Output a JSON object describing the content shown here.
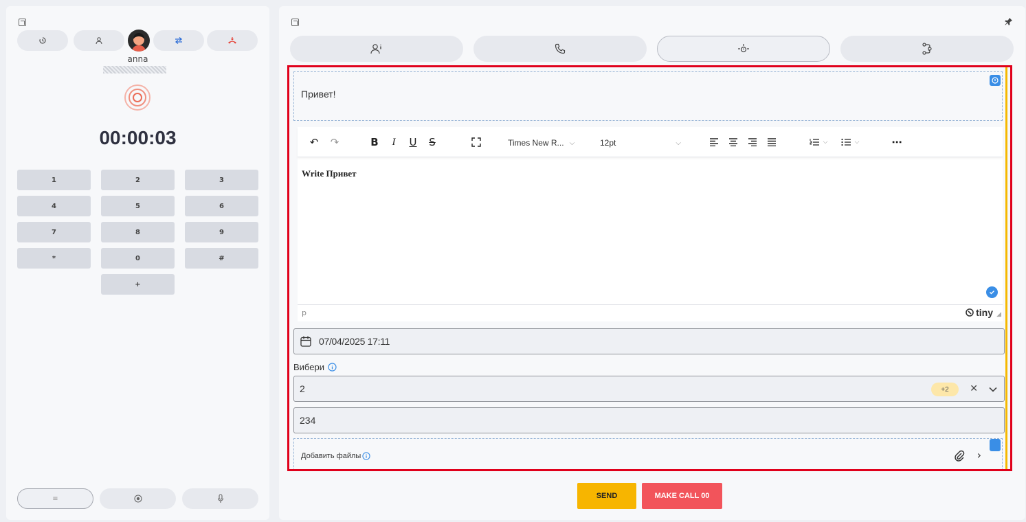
{
  "left_panel": {
    "caller_name": "anna",
    "caller_number_masked": "██████████",
    "timer": "00:00:03",
    "keypad": [
      "1",
      "2",
      "3",
      "4",
      "5",
      "6",
      "7",
      "8",
      "9",
      "*",
      "0",
      "#",
      "+"
    ],
    "bottom_buttons": [
      "menu-icon",
      "record-icon",
      "mic-icon"
    ]
  },
  "right_panel": {
    "tabs": [
      "contact-info-icon",
      "phone-icon",
      "hand-icon",
      "workflow-icon"
    ],
    "greeting_block": {
      "text": "Привет!"
    },
    "editor": {
      "font_family": "Times New R...",
      "font_size": "12pt",
      "content": "Write Привет",
      "status_path": "p",
      "brand": "tiny"
    },
    "datetime_field": {
      "value": "07/04/2025 17:11"
    },
    "select_label": "Вибери",
    "select_field": {
      "value": "2",
      "extra_badge": "+2"
    },
    "text_field": {
      "value": "234"
    },
    "files": {
      "label": "Добавить файлы"
    }
  },
  "actions": {
    "send_label": "SEND",
    "call_label": "MAKE CALL 00"
  },
  "colors": {
    "send": "#f7b500",
    "call": "#f2545b",
    "frame": "#e0001b",
    "accent_blue": "#3a8ee6",
    "badge": "#fde7a9",
    "side_bar": "#f5b800"
  }
}
